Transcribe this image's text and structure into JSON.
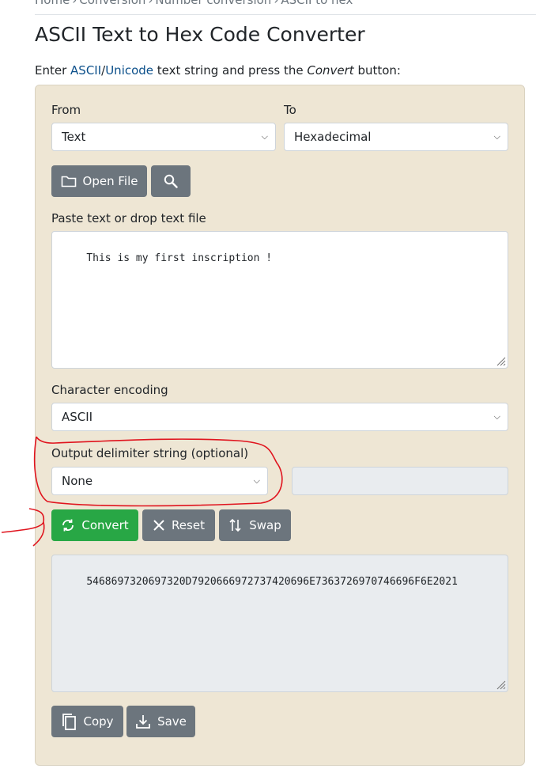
{
  "breadcrumb": {
    "items": [
      "Home",
      "Conversion",
      "Number conversion",
      "ASCII to hex"
    ],
    "separator": "›"
  },
  "page": {
    "title": "ASCII Text to Hex Code Converter",
    "intro_prefix": "Enter ",
    "intro_link_ascii": "ASCII",
    "intro_slash": "/",
    "intro_link_unicode": "Unicode",
    "intro_middle": " text string and press the ",
    "intro_emphasis": "Convert",
    "intro_suffix": " button:"
  },
  "form": {
    "from_label": "From",
    "from_value": "Text",
    "to_label": "To",
    "to_value": "Hexadecimal",
    "open_file_label": "Open File",
    "input_label": "Paste text or drop text file",
    "input_text": "This is my first inscription !",
    "encoding_label": "Character encoding",
    "encoding_value": "ASCII",
    "delimiter_label": "Output delimiter string (optional)",
    "delimiter_value": "None",
    "delimiter_custom": "",
    "convert_label": "Convert",
    "reset_label": "Reset",
    "swap_label": "Swap",
    "output_text": "5468697320697320D7920666972737420696E7363726970746696F6E2021",
    "copy_label": "Copy",
    "save_label": "Save"
  },
  "colors": {
    "panel_bg": "#eee6d4",
    "button_gray": "#6c757d",
    "button_green": "#28a745",
    "link_blue": "#0b4f8a",
    "annotation_red": "#e0141e"
  },
  "icons": {
    "open_file": "folder-icon",
    "search": "search-icon",
    "convert": "refresh-icon",
    "reset": "x-icon",
    "swap": "swap-arrows-icon",
    "copy": "copy-icon",
    "save": "download-icon",
    "select": "chevron-down-icon"
  }
}
